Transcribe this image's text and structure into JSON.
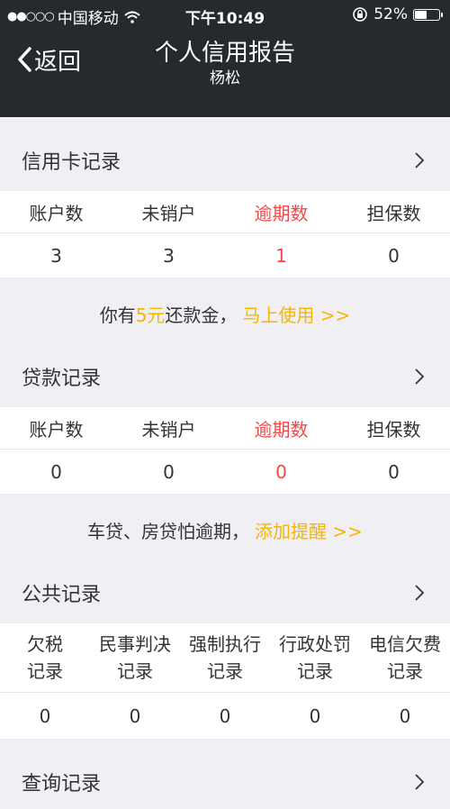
{
  "status_bar": {
    "signal": "●●○○○",
    "carrier": "中国移动",
    "time": "下午10:49",
    "battery": "52%",
    "battery_level": 0.52
  },
  "nav": {
    "back_label": "返回",
    "title": "个人信用报告",
    "subtitle": "杨松"
  },
  "credit_card": {
    "title": "信用卡记录",
    "columns": [
      "账户数",
      "未销户",
      "逾期数",
      "担保数"
    ],
    "values": [
      "3",
      "3",
      "1",
      "0"
    ]
  },
  "credit_promo": {
    "prefix": "你有",
    "amount": "5元",
    "suffix": "还款金，",
    "link": "马上使用 >>"
  },
  "loan": {
    "title": "贷款记录",
    "columns": [
      "账户数",
      "未销户",
      "逾期数",
      "担保数"
    ],
    "values": [
      "0",
      "0",
      "0",
      "0"
    ]
  },
  "loan_promo": {
    "text": "车贷、房贷怕逾期，",
    "link": "添加提醒 >>"
  },
  "public": {
    "title": "公共记录",
    "columns": [
      [
        "欠税",
        "记录"
      ],
      [
        "民事判决",
        "记录"
      ],
      [
        "强制执行",
        "记录"
      ],
      [
        "行政处罚",
        "记录"
      ],
      [
        "电信欠费",
        "记录"
      ]
    ],
    "values": [
      "0",
      "0",
      "0",
      "0",
      "0"
    ]
  },
  "query": {
    "title": "查询记录"
  },
  "colors": {
    "header_bg": "#262a2d",
    "overdue_red": "#f04a4a",
    "accent_yellow": "#f7b500",
    "page_bg": "#f0eff4"
  }
}
